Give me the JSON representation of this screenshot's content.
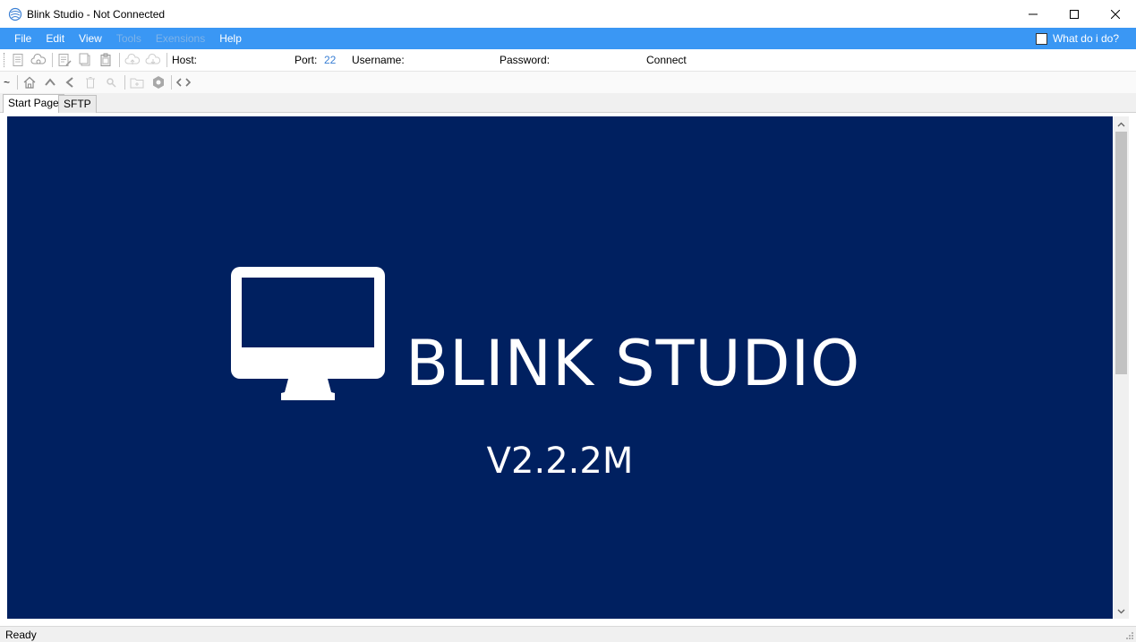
{
  "window": {
    "title": "Blink Studio - Not Connected",
    "icon": "blink-app-icon",
    "controls": [
      "minimize-icon",
      "maximize-icon",
      "close-icon"
    ]
  },
  "menu": {
    "items": [
      {
        "label": "File",
        "enabled": true
      },
      {
        "label": "Edit",
        "enabled": true
      },
      {
        "label": "View",
        "enabled": true
      },
      {
        "label": "Tools",
        "enabled": false
      },
      {
        "label": "Exensions",
        "enabled": false
      },
      {
        "label": "Help",
        "enabled": true
      }
    ],
    "what_do_label": "What do i do?"
  },
  "toolbar": {
    "host_label": "Host:",
    "host_value": "",
    "port_label": "Port:",
    "port_value": "22",
    "username_label": "Username:",
    "username_value": "",
    "password_label": "Password:",
    "password_value": "",
    "connect_label": "Connect"
  },
  "nav": {
    "path": "~"
  },
  "tabs": [
    {
      "label": "Start Page",
      "active": true
    },
    {
      "label": "SFTP",
      "active": false
    }
  ],
  "splash": {
    "brand": "BLINK STUDIO",
    "version": "V2.2.2M",
    "background": "#002060",
    "icon": "monitor-icon"
  },
  "status": {
    "text": "Ready"
  },
  "colors": {
    "menubar": "#3a97f4",
    "accent_text": "#3a7fd4"
  }
}
